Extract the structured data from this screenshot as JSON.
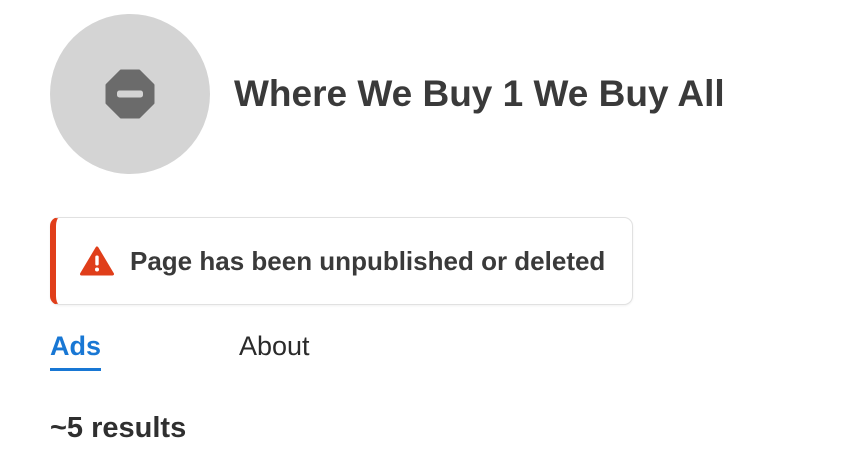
{
  "header": {
    "avatar_icon": "blocked-page-icon",
    "title": "Where We Buy 1 We Buy All"
  },
  "alert": {
    "icon": "warning-icon",
    "message": "Page has been unpublished or deleted",
    "accent_color": "#e03e1a"
  },
  "tabs": [
    {
      "label": "Ads",
      "active": true
    },
    {
      "label": "About",
      "active": false
    }
  ],
  "results": {
    "summary": "~5 results"
  },
  "colors": {
    "accent": "#1877d4",
    "avatar_bg": "#d4d4d4",
    "icon_gray": "#6b6b6b"
  }
}
